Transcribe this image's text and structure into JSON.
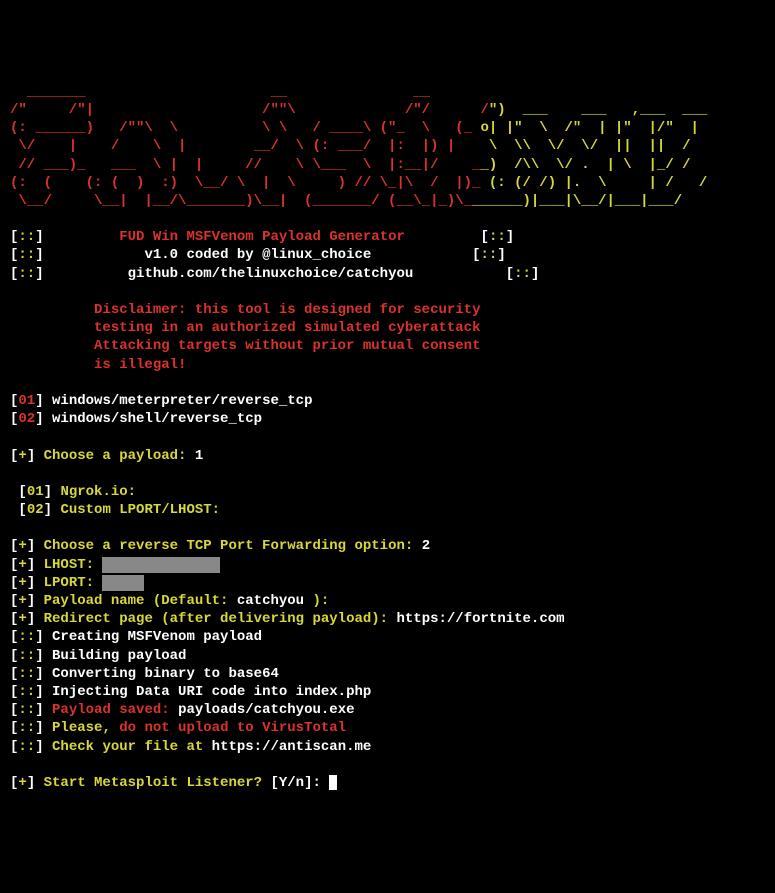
{
  "ascii": {
    "line1_red": "  _______                      __               __       ",
    "line1_yellow": "                           ",
    "line2_red": "/\"     /\"|                    /\"\"\\             /\"/      /",
    "line2_yellow": "\")  ___    ___   ,___  ___  ",
    "line3_red": "(: ______)   /\"\"\\  \\          \\ \\   / ____\\ (\"_  \\   (_ ",
    "line3_yellow": "o| |\"  \\  /\"  | |\"  |/\"  | ",
    "line4_red": " \\/    |    /    \\  |        __/  \\ (: ___/  |:  |) |   ",
    "line4_yellow": " \\  \\\\  \\/  \\/  ||  ||  /  ",
    "line5_red": " // ___)_   ___  \\ |  |     //    \\ \\___  \\  |:__|/    _",
    "line5_yellow": "_)  /\\\\  \\/ .  | \\  |_/ /  ",
    "line6_red": "(:  (    (: (  )  :)  \\__/ \\  |  \\     ) // \\_|\\  /  |)_ ",
    "line6_yellow": "(: (/ /) |.  \\     | /   /   ",
    "line7_red": " \\__/     \\__|  |__/\\_______)\\__|  (_______/ (__\\_|_)\\_",
    "line7_yellow": "______)|___|\\__/|___|___/    "
  },
  "header": {
    "title": "FUD Win MSFVenom Payload Generator",
    "version": "v1.0 coded by @linux_choice",
    "github": "github.com/thelinuxchoice/catchyou"
  },
  "disclaimer": {
    "l1": "Disclaimer: this tool is designed for security",
    "l2": "testing in an authorized simulated cyberattack",
    "l3": "Attacking targets without prior mutual consent",
    "l4": "is illegal!"
  },
  "payloads": {
    "opt1_num": "01",
    "opt1_txt": "windows/meterpreter/reverse_tcp",
    "opt2_num": "02",
    "opt2_txt": "windows/shell/reverse_tcp"
  },
  "choose_payload": {
    "prompt": "Choose a payload:",
    "value": "1"
  },
  "forwarding": {
    "opt1_num": "01",
    "opt1_txt": "Ngrok.io:",
    "opt2_num": "02",
    "opt2_txt": "Custom LPORT/LHOST:"
  },
  "fwd_prompt": {
    "prompt": "Choose a reverse TCP Port Forwarding option:",
    "value": "2"
  },
  "lhost": {
    "label": "LHOST:",
    "value": "              "
  },
  "lport": {
    "label": "LPORT:",
    "value": "     "
  },
  "payload_name": {
    "prompt": "Payload name (Default:",
    "default": "catchyou",
    "close": "):"
  },
  "redirect": {
    "prompt": "Redirect page (after delivering payload):",
    "value": "https://fortnite.com"
  },
  "status": {
    "s1": "Creating MSFVenom payload",
    "s2": "Building payload",
    "s3": "Converting binary to base64",
    "s4": "Injecting Data URI code into index.php",
    "saved_label": "Payload saved:",
    "saved_path": "payloads/catchyou.exe",
    "please": "Please,",
    "noupload": "do not upload to VirusTotal",
    "check": "Check your file at",
    "check_url": "https://antiscan.me"
  },
  "final": {
    "prompt": "Start Metasploit Listener?",
    "yn": "[Y/n]:"
  }
}
